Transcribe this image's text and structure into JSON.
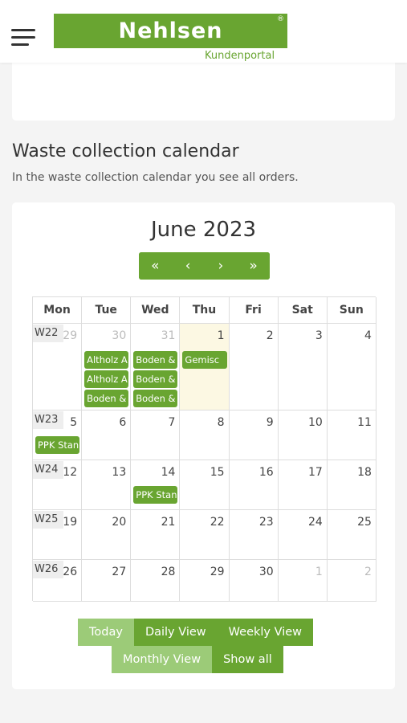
{
  "header": {
    "logo_text": "Nehlsen",
    "logo_registered": "®",
    "logo_subtitle": "Kundenportal"
  },
  "section": {
    "title": "Waste collection calendar",
    "description": "In the waste collection calendar you see all orders."
  },
  "calendar": {
    "title": "June 2023",
    "nav": {
      "prev_year": "«",
      "prev": "‹",
      "next": "›",
      "next_year": "»"
    },
    "day_headers": [
      "Mon",
      "Tue",
      "Wed",
      "Thu",
      "Fri",
      "Sat",
      "Sun"
    ],
    "weeks": [
      {
        "label": "W22",
        "days": [
          "29",
          "30",
          "31",
          "1",
          "2",
          "3",
          "4"
        ],
        "other": [
          true,
          true,
          true,
          false,
          false,
          false,
          false
        ]
      },
      {
        "label": "W23",
        "days": [
          "5",
          "6",
          "7",
          "8",
          "9",
          "10",
          "11"
        ],
        "other": [
          false,
          false,
          false,
          false,
          false,
          false,
          false
        ]
      },
      {
        "label": "W24",
        "days": [
          "12",
          "13",
          "14",
          "15",
          "16",
          "17",
          "18"
        ],
        "other": [
          false,
          false,
          false,
          false,
          false,
          false,
          false
        ]
      },
      {
        "label": "W25",
        "days": [
          "19",
          "20",
          "21",
          "22",
          "23",
          "24",
          "25"
        ],
        "other": [
          false,
          false,
          false,
          false,
          false,
          false,
          false
        ]
      },
      {
        "label": "W26",
        "days": [
          "26",
          "27",
          "28",
          "29",
          "30",
          "1",
          "2"
        ],
        "other": [
          false,
          false,
          false,
          false,
          false,
          true,
          true
        ]
      }
    ],
    "today_index": {
      "week": 0,
      "day": 3
    },
    "events": [
      {
        "week": 0,
        "day": 1,
        "slot": 0,
        "text": "Altholz A"
      },
      {
        "week": 0,
        "day": 1,
        "slot": 1,
        "text": "Altholz A"
      },
      {
        "week": 0,
        "day": 1,
        "slot": 2,
        "text": "Boden &"
      },
      {
        "week": 0,
        "day": 2,
        "slot": 0,
        "text": "Boden &"
      },
      {
        "week": 0,
        "day": 2,
        "slot": 1,
        "text": "Boden &"
      },
      {
        "week": 0,
        "day": 2,
        "slot": 2,
        "text": "Boden &"
      },
      {
        "week": 0,
        "day": 3,
        "slot": 0,
        "text": "Gemisc"
      },
      {
        "week": 1,
        "day": 0,
        "slot": 0,
        "text": "PPK Stan"
      },
      {
        "week": 2,
        "day": 2,
        "slot": 0,
        "text": "PPK Stan"
      }
    ]
  },
  "views": {
    "today": "Today",
    "daily": "Daily View",
    "weekly": "Weekly View",
    "monthly": "Monthly View",
    "show_all": "Show all"
  },
  "colors": {
    "brand_green": "#69a531",
    "active_green": "#9ccb78",
    "today_bg": "#fcf8e3"
  }
}
